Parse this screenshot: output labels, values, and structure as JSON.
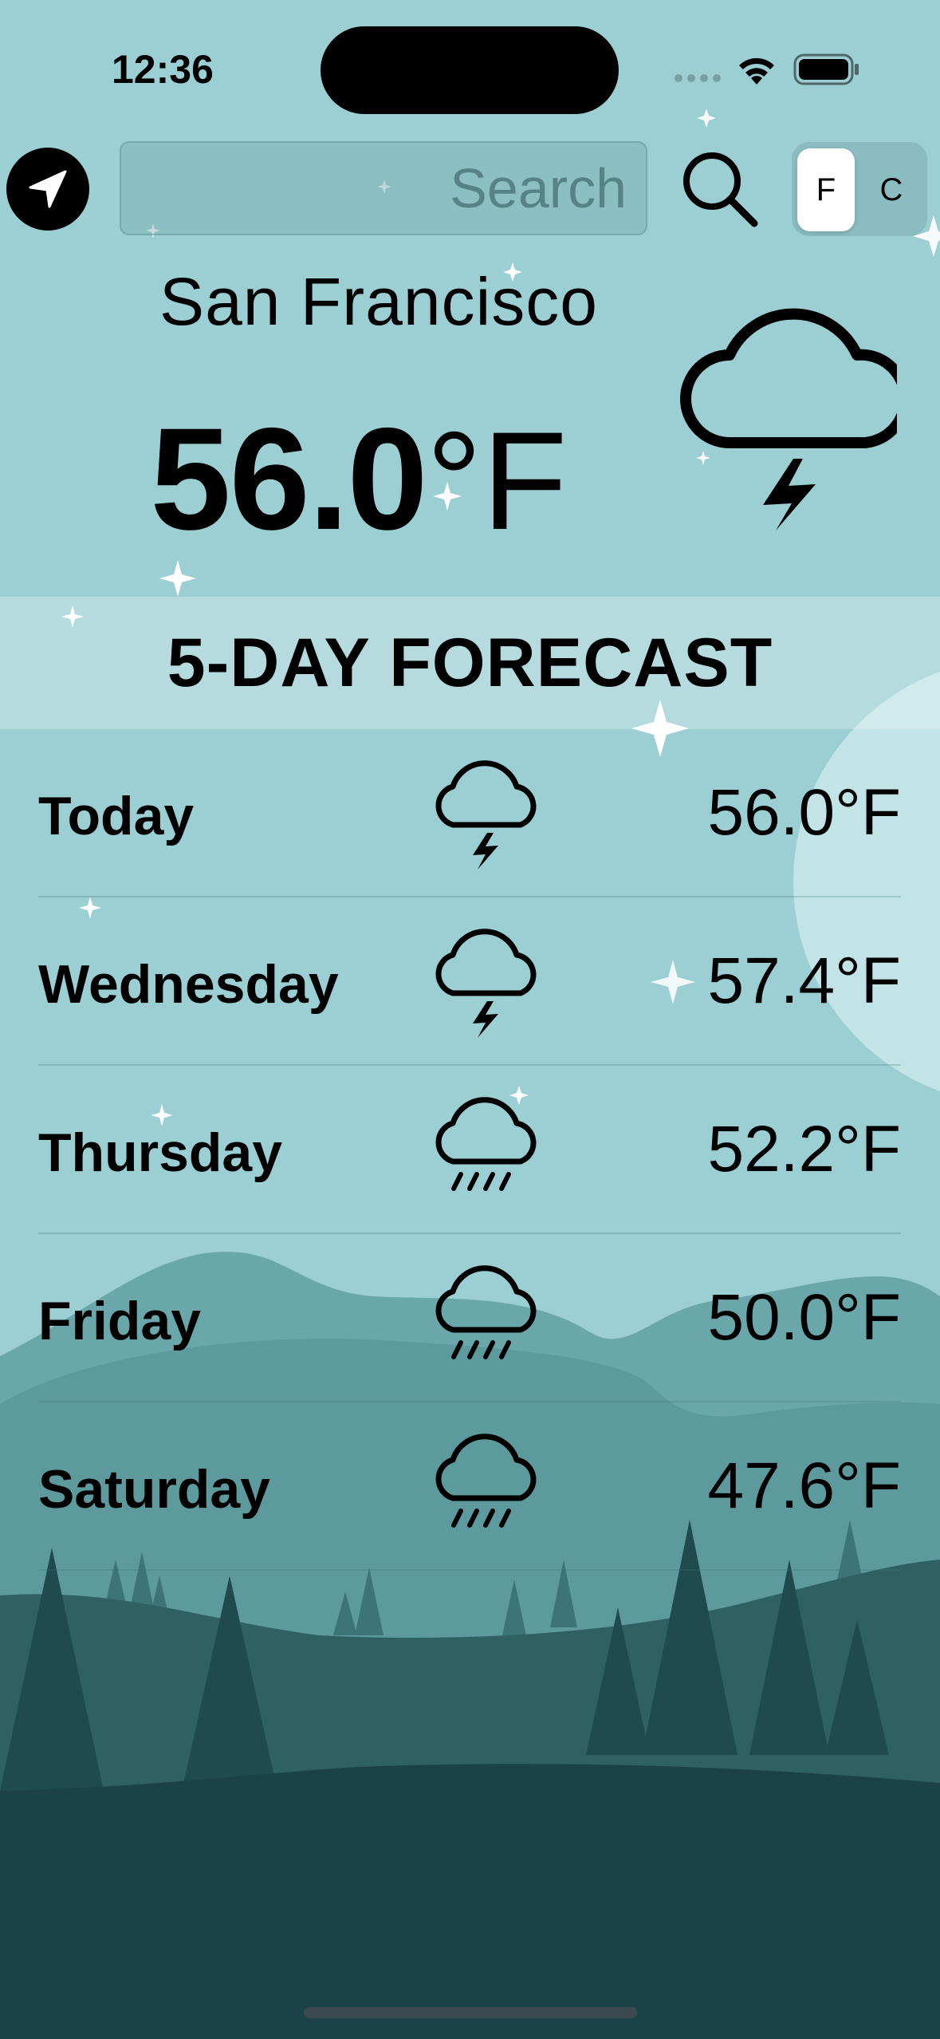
{
  "status_bar": {
    "time": "12:36"
  },
  "search": {
    "placeholder": "Search",
    "value": ""
  },
  "unit_toggle": {
    "f_label": "F",
    "c_label": "C",
    "selected": "F"
  },
  "current": {
    "city": "San Francisco",
    "temp_value": "56.0",
    "temp_unit": "°F",
    "icon": "cloud-lightning-icon"
  },
  "forecast": {
    "title": "5-DAY FORECAST",
    "days": [
      {
        "day": "Today",
        "icon": "cloud-lightning-icon",
        "temp_value": "56.0",
        "temp_unit": "°F"
      },
      {
        "day": "Wednesday",
        "icon": "cloud-lightning-icon",
        "temp_value": "57.4",
        "temp_unit": "°F"
      },
      {
        "day": "Thursday",
        "icon": "cloud-rain-icon",
        "temp_value": "52.2",
        "temp_unit": "°F"
      },
      {
        "day": "Friday",
        "icon": "cloud-rain-icon",
        "temp_value": "50.0",
        "temp_unit": "°F"
      },
      {
        "day": "Saturday",
        "icon": "cloud-rain-icon",
        "temp_value": "47.6",
        "temp_unit": "°F"
      }
    ]
  },
  "colors": {
    "sky": "#9ccfd3",
    "hill_far": "#6aa7ab",
    "hill_mid": "#2f6064",
    "ground": "#1b4248",
    "moon": "#c9e8ea"
  }
}
